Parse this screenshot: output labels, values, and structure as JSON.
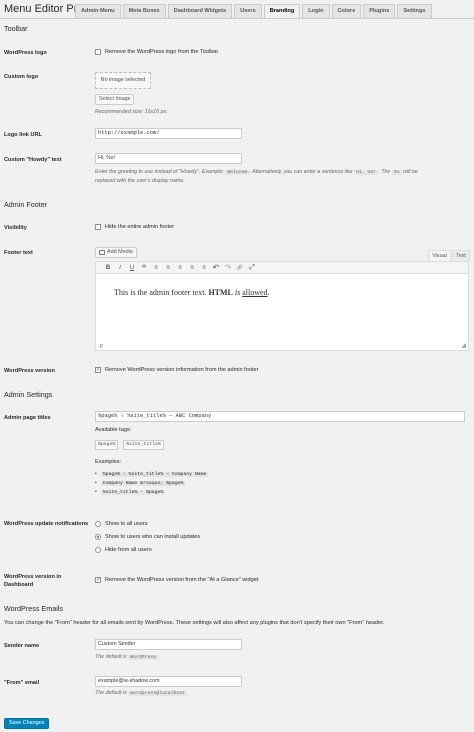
{
  "app": {
    "title": "Menu Editor Pro"
  },
  "tabs": [
    {
      "label": "Admin Menu"
    },
    {
      "label": "Meta Boxes"
    },
    {
      "label": "Dashboard Widgets"
    },
    {
      "label": "Users"
    },
    {
      "label": "Branding",
      "active": true
    },
    {
      "label": "Login"
    },
    {
      "label": "Colors"
    },
    {
      "label": "Plugins"
    },
    {
      "label": "Settings"
    }
  ],
  "toolbar_section": {
    "heading": "Toolbar",
    "wp_logo": {
      "label": "WordPress logo",
      "checkbox_text": "Remove the WordPress logo from the Toolbar",
      "checked": false
    },
    "custom_logo": {
      "label": "Custom logo",
      "placeholder_text": "No image selected",
      "button": "Select Image",
      "desc": "Recommended size: 16x16 px."
    },
    "logo_link": {
      "label": "Logo link URL",
      "value": "http://example.com/"
    },
    "howdy": {
      "label": "Custom \"Howdy\" text",
      "value": "Hi, %s!",
      "desc_1": "Enter the greeting to use instead of \"Howdy\". Example:",
      "desc_code_1": "Welcome",
      "desc_2": ". Alternatively, you can enter a sentence like",
      "desc_code_2": "Hi, %s!",
      "desc_3": ". The",
      "desc_code_3": "%s",
      "desc_4": "will be",
      "desc_5": "replaced with the user's display name."
    }
  },
  "footer_section": {
    "heading": "Admin Footer",
    "visibility": {
      "label": "Visibility",
      "checkbox_text": "Hide the entire admin footer",
      "checked": false
    },
    "footer_text": {
      "label": "Footer text",
      "add_media": "Add Media",
      "tab_visual": "Visual",
      "tab_text": "Text",
      "content_1": "This is the admin footer text.",
      "content_bold": "HTML",
      "content_2": "is",
      "content_link": "allowed",
      "content_end": ".",
      "path": "p"
    },
    "wp_version": {
      "label": "WordPress version",
      "checkbox_text": "Remove WordPress version information from the admin footer",
      "checked": true
    }
  },
  "admin_settings": {
    "heading": "Admin Settings",
    "page_titles": {
      "label": "Admin page titles",
      "value": "%page% ‹ %site_title% — ABC Company",
      "available_tags_label": "Available tags:",
      "tags": [
        "%page%",
        "%site_title%"
      ],
      "examples_label": "Examples:",
      "examples": [
        "%page% ‹ %site_title% — Company Name",
        "Company Name &rsaquo; %page%",
        "%site_title% - %page%"
      ]
    },
    "update_notifications": {
      "label": "WordPress update notifications",
      "options": [
        {
          "text": "Show to all users",
          "checked": false
        },
        {
          "text": "Show to users who can install updates",
          "checked": true
        },
        {
          "text": "Hide from all users",
          "checked": false
        }
      ]
    },
    "version_dashboard": {
      "label_1": "WordPress version in",
      "label_2": "Dashboard",
      "checkbox_text": "Remove the WordPress version from the \"At a Glance\" widget",
      "checked": true
    }
  },
  "emails_section": {
    "heading": "WordPress Emails",
    "intro": "You can change the \"From\" header for all emails sent by WordPress. These settings will also affect any plugins that don't specify their own \"From\" header.",
    "sender": {
      "label": "Sender name",
      "value": "Custom Sender",
      "default_text": "The default is",
      "default_code": "WordPress"
    },
    "from_email": {
      "label": "\"From\" email",
      "value": "example@w-shadow.com",
      "default_text": "The default is",
      "default_code": "wordpress@localhost"
    }
  },
  "save_button": "Save Changes",
  "icons": {
    "bold": "B",
    "italic": "I",
    "underline": "U",
    "blockquote": "“",
    "bullet_list": "≡",
    "numbered_list": "≡",
    "align_left": "≡",
    "align_center": "≡",
    "align_right": "≡",
    "undo": "↶",
    "redo": "↷",
    "link": "🔗",
    "fullscreen": "⤢"
  }
}
